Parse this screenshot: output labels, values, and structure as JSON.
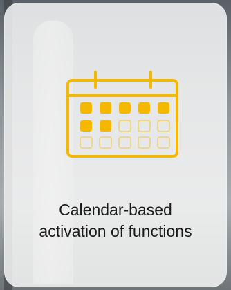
{
  "card": {
    "title_line1": "Calendar-based",
    "title_line2": "activation of functions",
    "icon": "calendar-icon",
    "accent_color": "#f5b800"
  }
}
